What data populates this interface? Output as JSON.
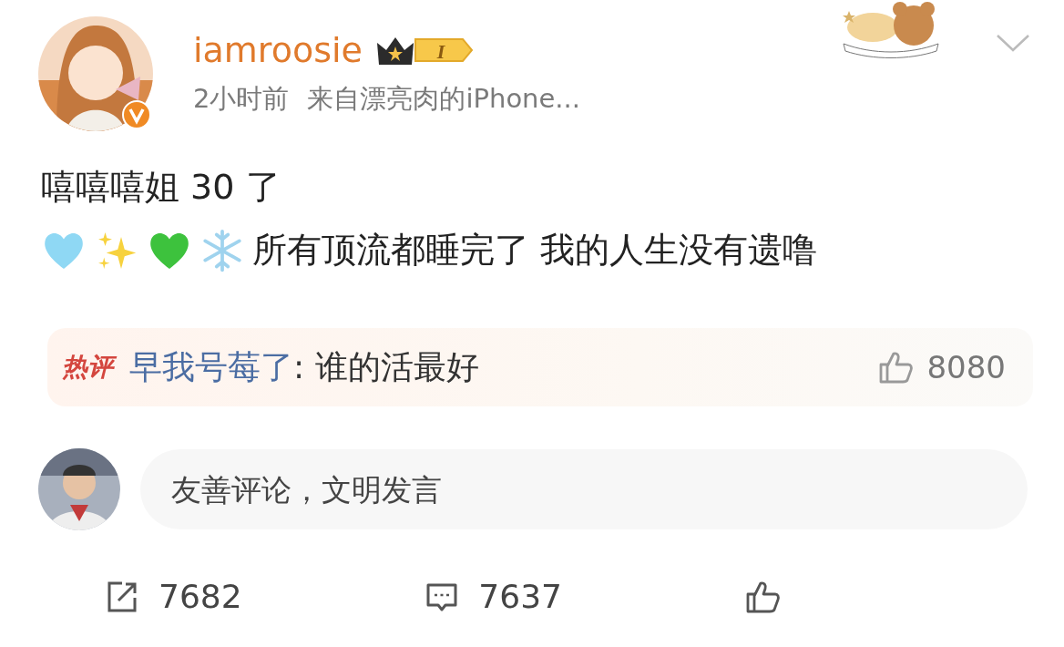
{
  "post": {
    "author": {
      "name": "iamroosie",
      "badge": "I"
    },
    "time": "2小时前",
    "source": "来自漂亮肉的iPhone...",
    "lines": [
      {
        "text": "嘻嘻嘻姐 30 了"
      },
      {
        "text": "所有顶流都睡完了 我的人生没有遗噜",
        "icons": [
          {
            "kind": "heart",
            "color": "#8fd8f4"
          },
          {
            "kind": "sparkles"
          },
          {
            "kind": "heart",
            "color": "#3dc23d"
          },
          {
            "kind": "snowflake"
          }
        ]
      }
    ]
  },
  "hot_comment": {
    "label": "热评",
    "user": "早我号莓了",
    "text": ": 谁的活最好",
    "likes": "8080"
  },
  "composer": {
    "placeholder": "友善评论，文明发言"
  },
  "actions": [
    {
      "kind": "repost",
      "count": "7682"
    },
    {
      "kind": "comment",
      "count": "7637"
    },
    {
      "kind": "like"
    }
  ]
}
